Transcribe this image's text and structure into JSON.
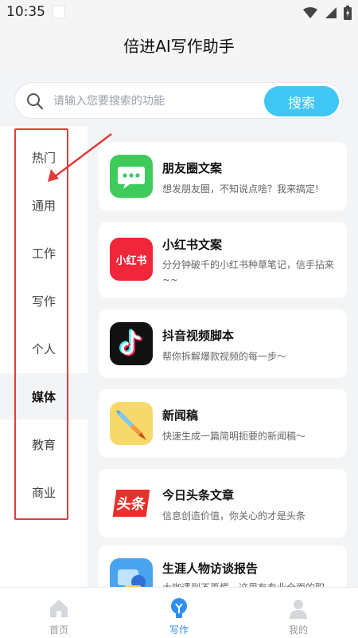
{
  "status": {
    "time": "10:35"
  },
  "header": {
    "title": "倍进AI写作助手"
  },
  "search": {
    "placeholder": "请输入您要搜索的功能",
    "button": "搜索"
  },
  "sidebar": {
    "items": [
      {
        "label": "热门"
      },
      {
        "label": "通用"
      },
      {
        "label": "工作"
      },
      {
        "label": "写作"
      },
      {
        "label": "个人"
      },
      {
        "label": "媒体"
      },
      {
        "label": "教育"
      },
      {
        "label": "商业"
      }
    ],
    "active": "媒体"
  },
  "cards": [
    {
      "title": "朋友圈文案",
      "desc": "想发朋友圈，不知说点啥？我来搞定!",
      "icon": "wechat-moments-icon"
    },
    {
      "title": "小红书文案",
      "desc": "分分钟破千的小红书种草笔记，信手拈来~~",
      "icon": "xiaohongshu-icon"
    },
    {
      "title": "抖音视频脚本",
      "desc": "帮你拆解爆款视频的每一步～",
      "icon": "douyin-icon"
    },
    {
      "title": "新闻稿",
      "desc": "快速生成一篇简明扼要的新闻稿～",
      "icon": "pen-icon"
    },
    {
      "title": "今日头条文章",
      "desc": "信息创造价值，你关心的才是头条",
      "icon": "toutiao-icon",
      "logo_text": "头条"
    },
    {
      "title": "生涯人物访谈报告",
      "desc": "大咖遇到不再慌，这里有专业全面的职",
      "icon": "interview-icon"
    }
  ],
  "xhs_logo_text": "小红书",
  "tabs": [
    {
      "label": "首页",
      "icon": "home-icon"
    },
    {
      "label": "写作",
      "icon": "writing-bulb-icon"
    },
    {
      "label": "我的",
      "icon": "user-icon"
    }
  ],
  "colors": {
    "accent": "#3fc6f5",
    "active_tab": "#2e8ef0",
    "annotation": "#e23b3b"
  }
}
